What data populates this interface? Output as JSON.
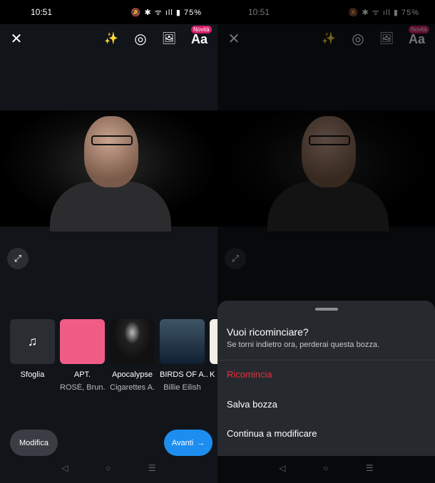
{
  "status": {
    "time": "10:51",
    "icons": "🔕 ✱ ᯤ ıll ▮",
    "battery": "75%"
  },
  "toolbar": {
    "close": "✕",
    "magic": "✨",
    "filters": "◎",
    "gallery": "🖼",
    "text": "Aa",
    "badge": "Novità"
  },
  "expand_icon": "⤢",
  "tracks": [
    {
      "title": "Sfoglia",
      "subtitle": ""
    },
    {
      "title": "APT.",
      "subtitle": "ROSÉ, Brun.."
    },
    {
      "title": "Apocalypse",
      "subtitle": "Cigarettes A.."
    },
    {
      "title": "BIRDS OF A..",
      "subtitle": "Billie Eilish"
    },
    {
      "title": "K",
      "subtitle": ""
    }
  ],
  "buttons": {
    "edit": "Modifica",
    "next": "Avanti",
    "next_arrow": "→"
  },
  "nav": {
    "back": "◁",
    "home": "○",
    "recents": "☰"
  },
  "sheet": {
    "title": "Vuoi ricominciare?",
    "subtitle": "Se torni indietro ora, perderai questa bozza.",
    "options": [
      "Ricomincia",
      "Salva bozza",
      "Continua a modificare"
    ]
  },
  "colors": {
    "accent": "#1d8ef0",
    "danger": "#e5303a",
    "badge": "#d3206a"
  }
}
